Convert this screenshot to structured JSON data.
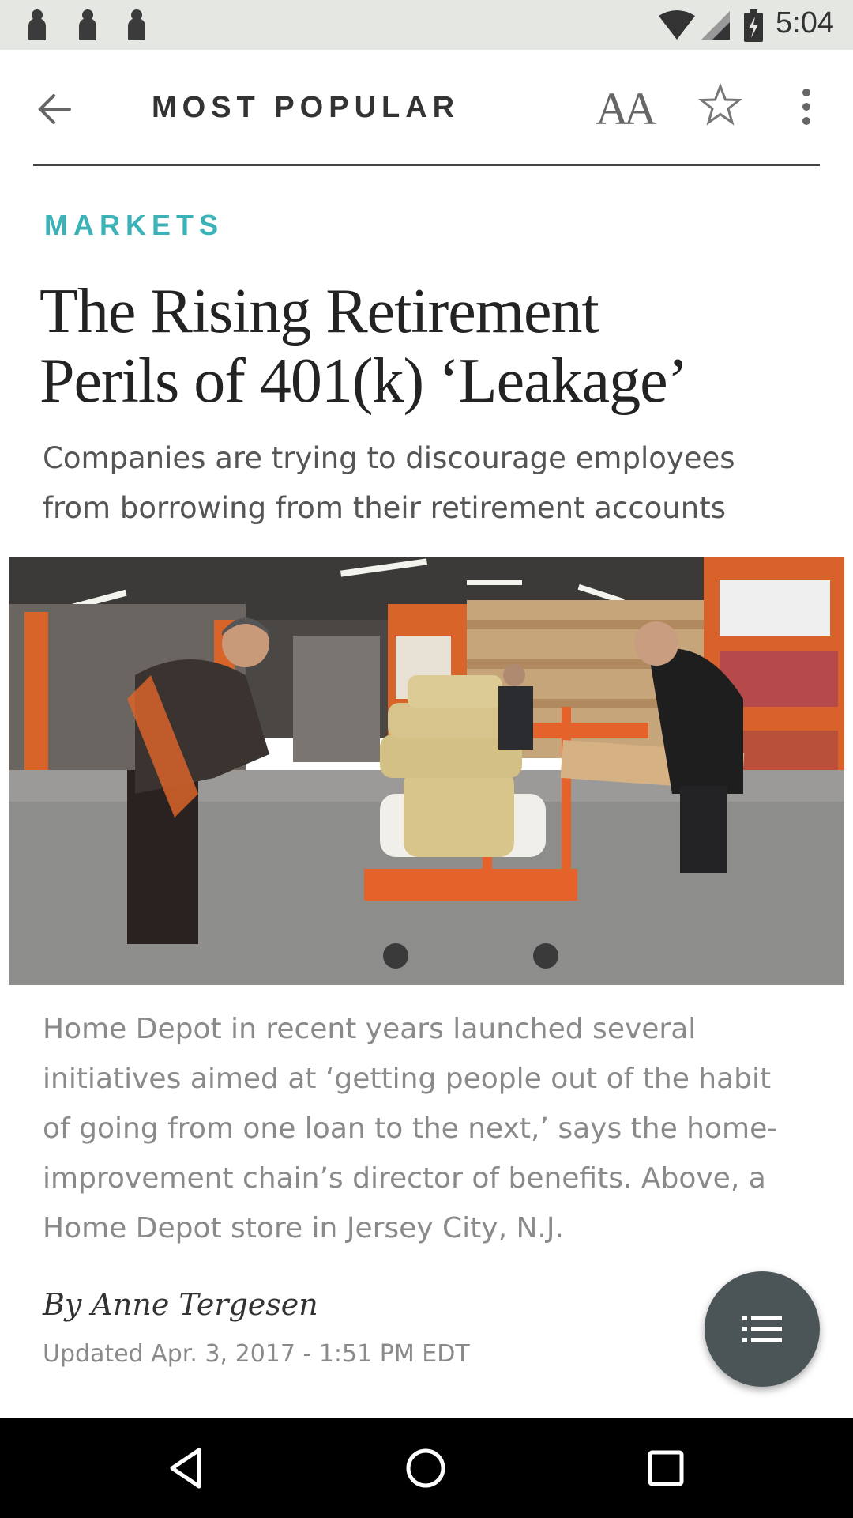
{
  "status_bar": {
    "time": "5:04",
    "notification_icons": [
      "person-icon",
      "person-icon",
      "person-icon"
    ],
    "icons": [
      "wifi-icon",
      "cell-signal-icon",
      "battery-charging-icon"
    ]
  },
  "header": {
    "title": "MOST POPULAR",
    "text_size_label": "AA"
  },
  "article": {
    "category": "MARKETS",
    "headline_line1": "The Rising Retirement",
    "headline_line2": "Perils of 401(k) ‘Leakage’",
    "dek_line1": "Companies are trying to discourage employees",
    "dek_line2": "from borrowing from their retirement accounts",
    "caption_lines": [
      "Home Depot in recent years launched several",
      "initiatives aimed at ‘getting people out of the habit",
      "of going from one loan to the next,’ says the home-",
      "improvement chain’s director of benefits. Above, a",
      "Home Depot store in Jersey City, N.J."
    ],
    "byline": "By Anne Tergesen",
    "timestamp": "Updated Apr. 3, 2017 - 1:51 PM EDT"
  },
  "colors": {
    "accent": "#3bb2b7",
    "fab": "#4b5557",
    "status_bar": "#e5e7e3"
  },
  "nav_bar": {
    "icons": [
      "back-triangle-icon",
      "home-circle-icon",
      "recents-square-icon"
    ]
  }
}
